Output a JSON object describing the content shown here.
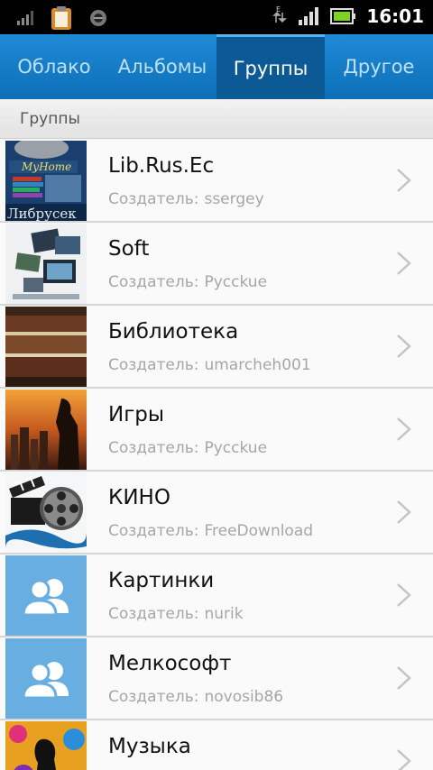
{
  "status_bar": {
    "time": "16:01",
    "network_label": "E"
  },
  "tabs": [
    {
      "label": "Облако",
      "active": false
    },
    {
      "label": "Альбомы",
      "active": false
    },
    {
      "label": "Группы",
      "active": true
    },
    {
      "label": "Другое",
      "active": false
    }
  ],
  "section": {
    "title": "Группы"
  },
  "creator_label": "Создатель:",
  "groups": [
    {
      "title": "Lib.Rus.Ec",
      "creator": "ssergey",
      "thumb": "librusec-image",
      "thumb_text_top": "MyHome",
      "thumb_text_bottom": "Либрусек"
    },
    {
      "title": "Soft",
      "creator": "Pycckue",
      "thumb": "software-screens-image"
    },
    {
      "title": "Библиотека",
      "creator": "umarcheh001",
      "thumb": "books-image"
    },
    {
      "title": "Игры",
      "creator": "Pycckue",
      "thumb": "city-sunset-image"
    },
    {
      "title": "КИНО",
      "creator": "FreeDownload",
      "thumb": "film-reel-image"
    },
    {
      "title": "Картинки",
      "creator": "nurik",
      "thumb": "group-default-icon"
    },
    {
      "title": "Мелкософт",
      "creator": "novosib86",
      "thumb": "group-default-icon"
    },
    {
      "title": "Музыка",
      "creator": "",
      "thumb": "music-silhouette-image"
    }
  ],
  "colors": {
    "accent": "#1f8ad6",
    "active_tab": "#0b5a96",
    "avatar_bg": "#69aee0"
  }
}
